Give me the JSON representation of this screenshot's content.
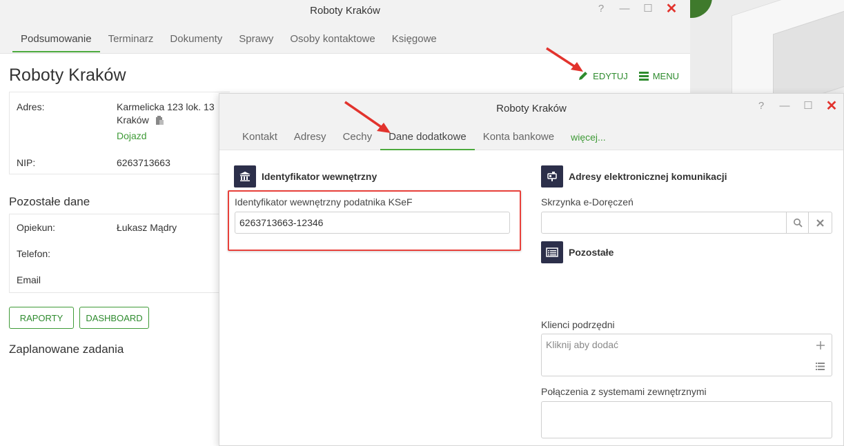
{
  "back_window": {
    "title": "Roboty Kraków",
    "controls": [
      "?",
      "—",
      "☐",
      "✕"
    ],
    "tabs": [
      "Podsumowanie",
      "Terminarz",
      "Dokumenty",
      "Sprawy",
      "Osoby kontaktowe",
      "Księgowe"
    ],
    "active_tab": "Podsumowanie",
    "page_title": "Roboty Kraków",
    "actions": {
      "edit": "EDYTUJ",
      "menu": "MENU"
    },
    "address": {
      "label": "Adres:",
      "line1": "Karmelicka 123 lok. 13",
      "line2": "Kraków",
      "link": "Dojazd"
    },
    "nip": {
      "label": "NIP:",
      "value": "6263713663"
    },
    "other_title": "Pozostałe dane",
    "other": {
      "caretaker_label": "Opiekun:",
      "caretaker_value": "Łukasz Mądry",
      "phone_label": "Telefon:",
      "email_label": "Email"
    },
    "buttons": {
      "reports": "RAPORTY",
      "dashboard": "DASHBOARD"
    },
    "planned_title": "Zaplanowane zadania"
  },
  "front_window": {
    "title": "Roboty Kraków",
    "controls": [
      "?",
      "—",
      "☐",
      "✕"
    ],
    "tabs": [
      "Kontakt",
      "Adresy",
      "Cechy",
      "Dane dodatkowe",
      "Konta bankowe"
    ],
    "active_tab": "Dane dodatkowe",
    "more_tab": "więcej...",
    "internal_id": {
      "section_title": "Identyfikator wewnętrzny",
      "field_label": "Identyfikator wewnętrzny podatnika KSeF",
      "field_value": "6263713663-12346"
    },
    "electronic": {
      "section_title": "Adresy elektronicznej komunikacji",
      "field_label": "Skrzynka e-Doręczeń",
      "field_value": ""
    },
    "other": {
      "section_title": "Pozostałe",
      "subclients_label": "Klienci podrzędni",
      "subclients_placeholder": "Kliknij aby dodać",
      "external_label": "Połączenia z systemami zewnętrznymi"
    }
  },
  "colors": {
    "accent_green": "#3e9a36",
    "close_red": "#e2332d",
    "highlight_red": "#e8403a",
    "icon_bg": "#2c2f4a"
  }
}
